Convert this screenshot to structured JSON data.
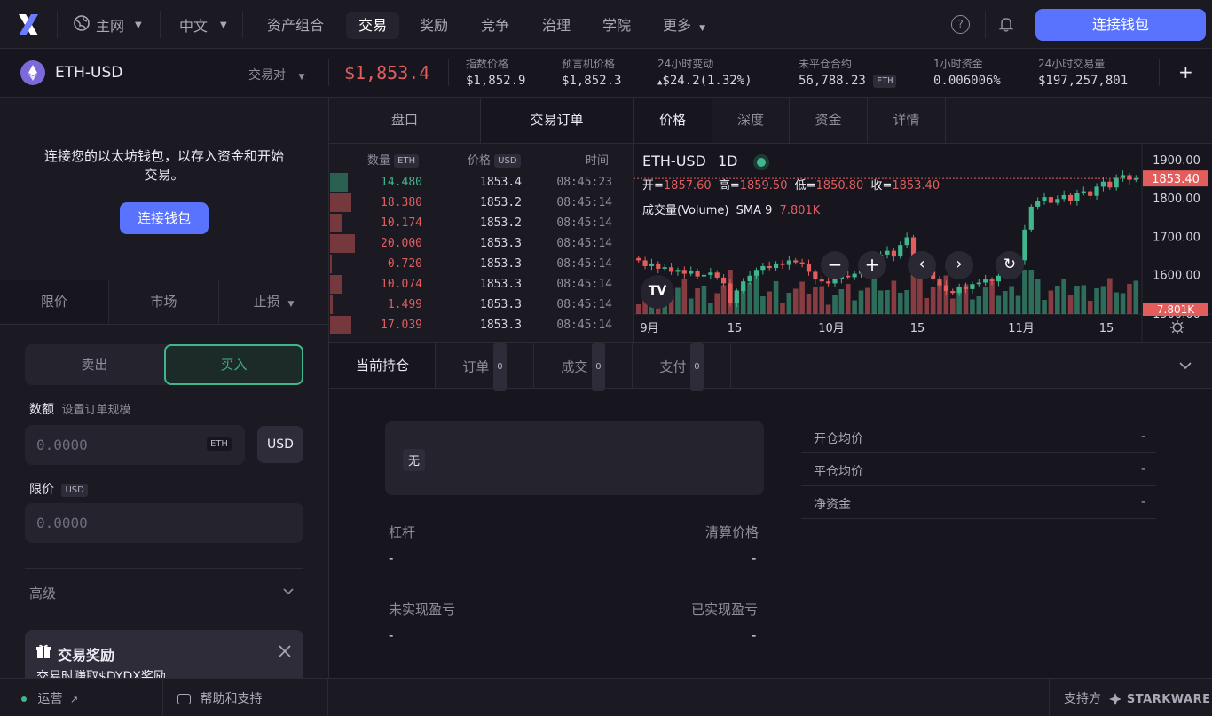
{
  "nav": {
    "network": "主网",
    "language": "中文",
    "items": [
      "资产组合",
      "交易",
      "奖励",
      "竞争",
      "治理",
      "学院",
      "更多"
    ],
    "connect_wallet": "连接钱包"
  },
  "market": {
    "pair": "ETH-USD",
    "pair_selector": "交易对",
    "price": "$1,853.4",
    "index_price_label": "指数价格",
    "index_price": "$1,852.9",
    "oracle_price_label": "预言机价格",
    "oracle_price": "$1,852.3",
    "change_label": "24小时变动",
    "change": "$24.2",
    "change_pct": "(1.32%)",
    "oi_label": "未平仓合约",
    "oi": "56,788.23",
    "oi_unit": "ETH",
    "funding_label": "1小时资金",
    "funding": "0.006006%",
    "volume_label": "24小时交易量",
    "volume": "$197,257,801",
    "add": "+"
  },
  "left": {
    "connect_msg": "连接您的以太坊钱包，以存入资金和开始交易。",
    "connect_btn": "连接钱包",
    "order_types": [
      "限价",
      "市场",
      "止损"
    ],
    "sell": "卖出",
    "buy": "买入",
    "amount_label": "数额",
    "amount_hint": "设置订单规模",
    "amount_placeholder": "0.0000",
    "amount_unit": "ETH",
    "usd_toggle": "USD",
    "limit_label": "限价",
    "limit_unit": "USD",
    "limit_placeholder": "0.0000",
    "advanced": "高级",
    "reward_title": "交易奖励",
    "reward_sub": "交易时赚取$DYDX奖励"
  },
  "orderbook": {
    "tabs": [
      "盘口",
      "交易订单"
    ],
    "col_size": "数量",
    "col_size_unit": "ETH",
    "col_price": "价格",
    "col_price_unit": "USD",
    "col_time": "时间",
    "rows": [
      {
        "size": "14.480",
        "price": "1853.4",
        "time": "08:45:23",
        "side": "buy",
        "bar": 0.7
      },
      {
        "size": "18.380",
        "price": "1853.2",
        "time": "08:45:14",
        "side": "sell",
        "bar": 0.85
      },
      {
        "size": "10.174",
        "price": "1853.2",
        "time": "08:45:14",
        "side": "sell",
        "bar": 0.5
      },
      {
        "size": "20.000",
        "price": "1853.3",
        "time": "08:45:14",
        "side": "sell",
        "bar": 1.0
      },
      {
        "size": "0.720",
        "price": "1853.3",
        "time": "08:45:14",
        "side": "sell",
        "bar": 0.08
      },
      {
        "size": "10.074",
        "price": "1853.3",
        "time": "08:45:14",
        "side": "sell",
        "bar": 0.5
      },
      {
        "size": "1.499",
        "price": "1853.3",
        "time": "08:45:14",
        "side": "sell",
        "bar": 0.12
      },
      {
        "size": "17.039",
        "price": "1853.3",
        "time": "08:45:14",
        "side": "sell",
        "bar": 0.85
      }
    ]
  },
  "chart_tabs": [
    "价格",
    "深度",
    "资金",
    "详情"
  ],
  "chart_data": {
    "type": "candlestick",
    "symbol": "ETH-USD",
    "interval": "1D",
    "ohlc_labels": {
      "o": "开=",
      "h": "高=",
      "l": "低=",
      "c": "收="
    },
    "open": "1857.60",
    "high": "1859.50",
    "low": "1850.80",
    "close": "1853.40",
    "volume_label": "成交量(Volume)",
    "sma_label": "SMA 9",
    "sma_value": "7.801K",
    "volume_badge": "7.801K",
    "last_price_badge": "1853.40",
    "y_ticks": [
      "1900.00",
      "1800.00",
      "1700.00",
      "1600.00",
      "1500.00"
    ],
    "ylim": [
      1500,
      1930
    ],
    "x_ticks": [
      "9月",
      "15",
      "10月",
      "15",
      "11月",
      "15"
    ],
    "closes": [
      1640,
      1625,
      1632,
      1618,
      1622,
      1610,
      1615,
      1605,
      1612,
      1598,
      1602,
      1608,
      1595,
      1580,
      1530,
      1560,
      1585,
      1600,
      1615,
      1625,
      1620,
      1632,
      1628,
      1640,
      1635,
      1630,
      1610,
      1590,
      1585,
      1580,
      1592,
      1600,
      1596,
      1605,
      1620,
      1615,
      1630,
      1655,
      1665,
      1650,
      1680,
      1700,
      1645,
      1622,
      1610,
      1590,
      1575,
      1560,
      1555,
      1570,
      1565,
      1578,
      1582,
      1590,
      1585,
      1600,
      1610,
      1615,
      1640,
      1720,
      1780,
      1795,
      1805,
      1790,
      1800,
      1810,
      1795,
      1815,
      1820,
      1808,
      1832,
      1845,
      1830,
      1855,
      1862,
      1850,
      1853
    ]
  },
  "positions": {
    "tabs": [
      {
        "label": "当前持仓",
        "count": ""
      },
      {
        "label": "订单",
        "count": "0"
      },
      {
        "label": "成交",
        "count": "0"
      },
      {
        "label": "支付",
        "count": "0"
      }
    ],
    "none": "无",
    "leverage": "杠杆",
    "liq_price": "清算价格",
    "unrealized": "未实现盈亏",
    "realized": "已实现盈亏",
    "dash": "-",
    "details": [
      {
        "label": "开仓均价",
        "value": "-"
      },
      {
        "label": "平仓均价",
        "value": "-"
      },
      {
        "label": "净资金",
        "value": "-"
      }
    ]
  },
  "footer": {
    "status": "运营",
    "help": "帮助和支持",
    "powered": "支持方",
    "starkware": "STARKWARE"
  },
  "colors": {
    "accent": "#5973fe",
    "up": "#3fb68b",
    "down": "#e35d5d"
  }
}
